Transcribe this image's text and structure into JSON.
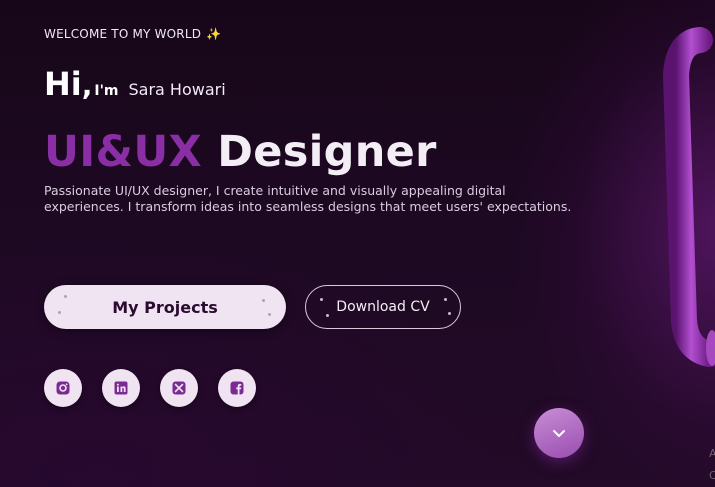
{
  "hero": {
    "eyebrow": "WELCOME TO MY WORLD",
    "eyebrow_icon": "sparkles-icon",
    "greeting_hi": "Hi",
    "greeting_comma": ",",
    "greeting_im": "I'm",
    "name": "Sara Howari",
    "headline_accent": "UI&UX",
    "headline_rest": "Designer",
    "bio": "Passionate UI/UX designer, I create intuitive and visually appealing digital experiences. I transform ideas into seamless designs that meet users' expectations.",
    "accent_color": "#8a2ea6"
  },
  "buttons": {
    "primary": "My Projects",
    "secondary": "Download CV"
  },
  "socials": [
    {
      "icon": "instagram-icon"
    },
    {
      "icon": "linkedin-icon"
    },
    {
      "icon": "x-icon"
    },
    {
      "icon": "facebook-icon"
    }
  ],
  "scroll": {
    "icon": "chevron-down-icon"
  },
  "corner_text": "A\nC"
}
